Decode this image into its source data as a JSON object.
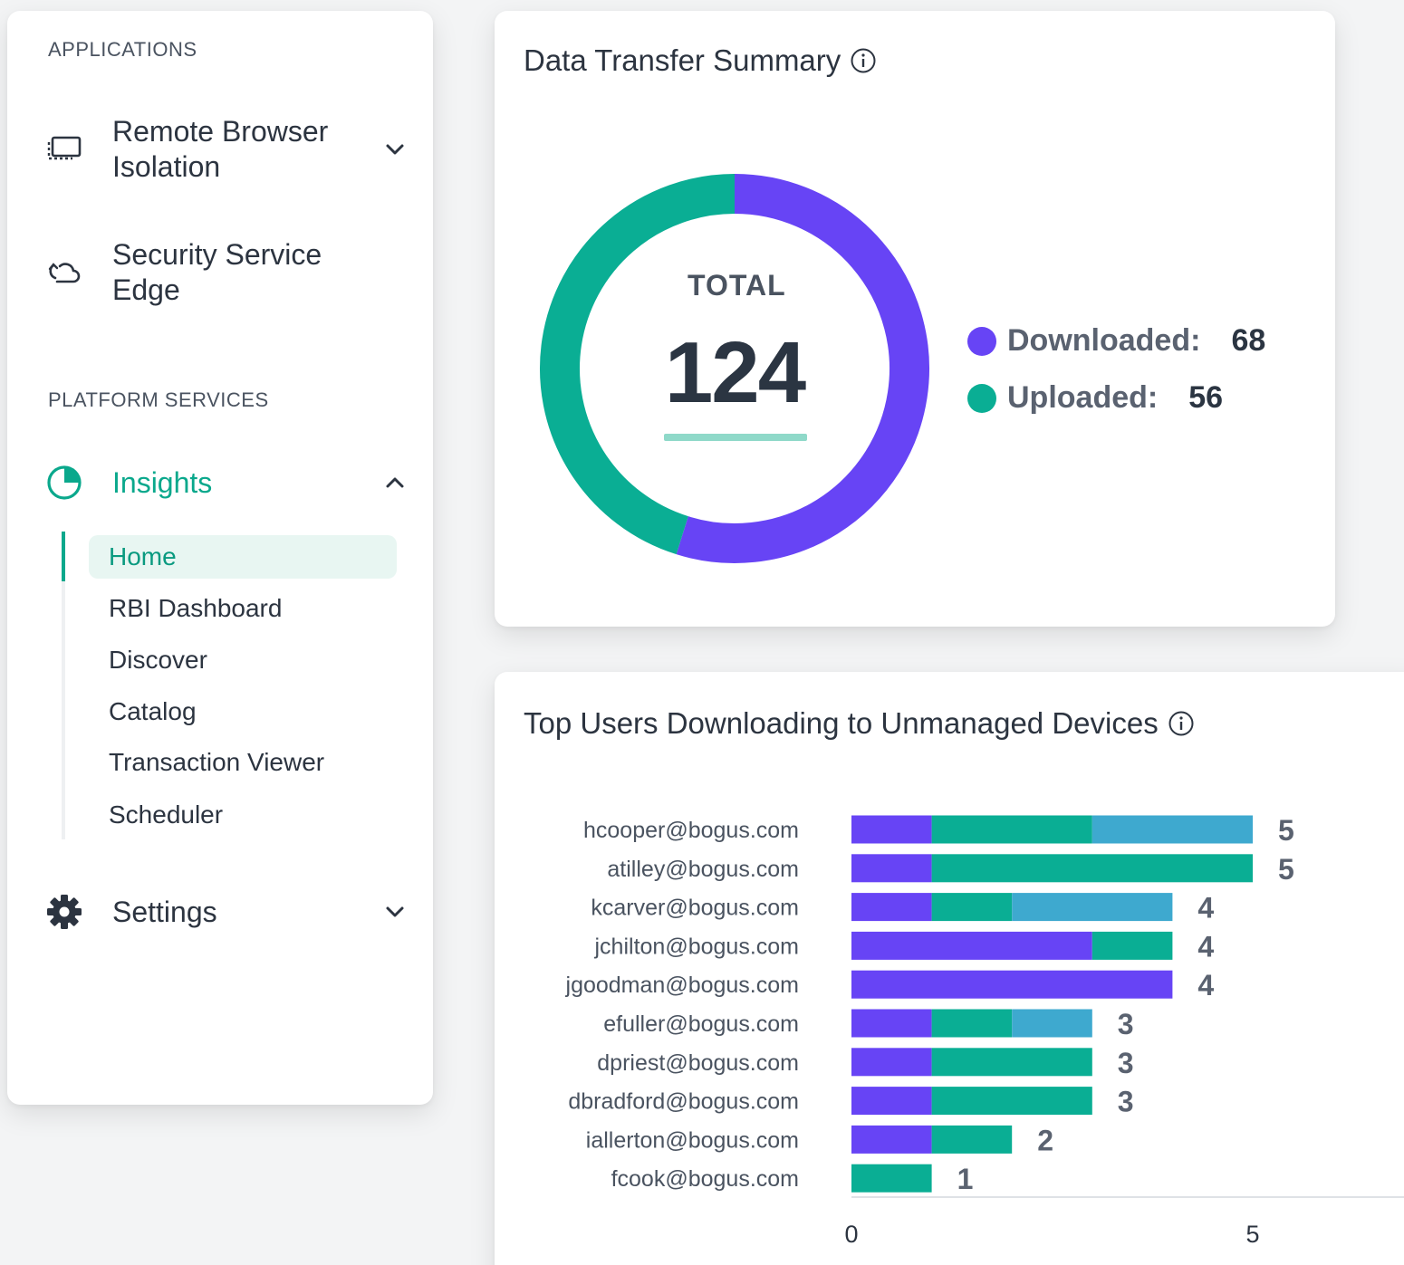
{
  "sidebar": {
    "applications_label": "APPLICATIONS",
    "platform_label": "PLATFORM SERVICES",
    "rbi_label": "Remote Browser Isolation",
    "sse_label": "Security Service Edge",
    "insights_label": "Insights",
    "settings_label": "Settings",
    "subitems": [
      "Home",
      "RBI Dashboard",
      "Discover",
      "Catalog",
      "Transaction Viewer",
      "Scheduler"
    ],
    "active_subitem": "Home"
  },
  "colors": {
    "accent": "#0aa88c",
    "downloaded": "#6744f5",
    "uploaded": "#0aae94",
    "third": "#3ea9cf"
  },
  "transfer": {
    "title": "Data Transfer Summary",
    "total_label": "TOTAL",
    "total_value": "124",
    "downloaded_label": "Downloaded:",
    "downloaded_value": "68",
    "uploaded_label": "Uploaded:",
    "uploaded_value": "56"
  },
  "top_users": {
    "title": "Top Users Downloading to Unmanaged Devices"
  },
  "chart_data": [
    {
      "type": "pie",
      "categories": [
        "Downloaded",
        "Uploaded"
      ],
      "values": [
        68,
        56
      ],
      "total": 124
    },
    {
      "type": "bar",
      "orientation": "horizontal",
      "stacked": true,
      "categories": [
        "hcooper@bogus.com",
        "atilley@bogus.com",
        "kcarver@bogus.com",
        "jchilton@bogus.com",
        "jgoodman@bogus.com",
        "efuller@bogus.com",
        "dpriest@bogus.com",
        "dbradford@bogus.com",
        "iallerton@bogus.com",
        "fcook@bogus.com"
      ],
      "series": [
        {
          "color": "#6744f5",
          "values": [
            1,
            1,
            1,
            3,
            4,
            1,
            1,
            1,
            1,
            0
          ]
        },
        {
          "color": "#0aae94",
          "values": [
            2,
            4,
            1,
            1,
            0,
            1,
            2,
            2,
            1,
            1
          ]
        },
        {
          "color": "#3ea9cf",
          "values": [
            2,
            0,
            2,
            0,
            0,
            1,
            0,
            0,
            0,
            0
          ]
        }
      ],
      "totals": [
        5,
        5,
        4,
        4,
        4,
        3,
        3,
        3,
        2,
        1
      ],
      "xticks": [
        "0",
        "5"
      ],
      "xlim": [
        0,
        5
      ]
    }
  ]
}
